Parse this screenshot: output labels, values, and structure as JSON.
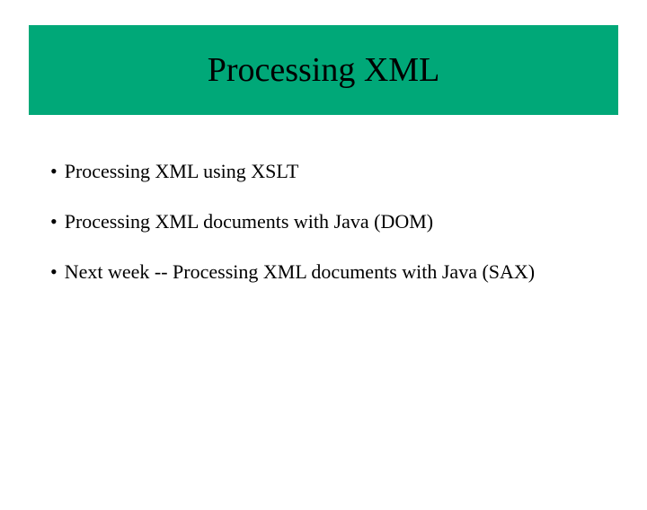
{
  "title": "Processing XML",
  "bullets": [
    "Processing XML using XSLT",
    "Processing XML documents with Java (DOM)",
    "Next week -- Processing XML documents with Java (SAX)"
  ]
}
